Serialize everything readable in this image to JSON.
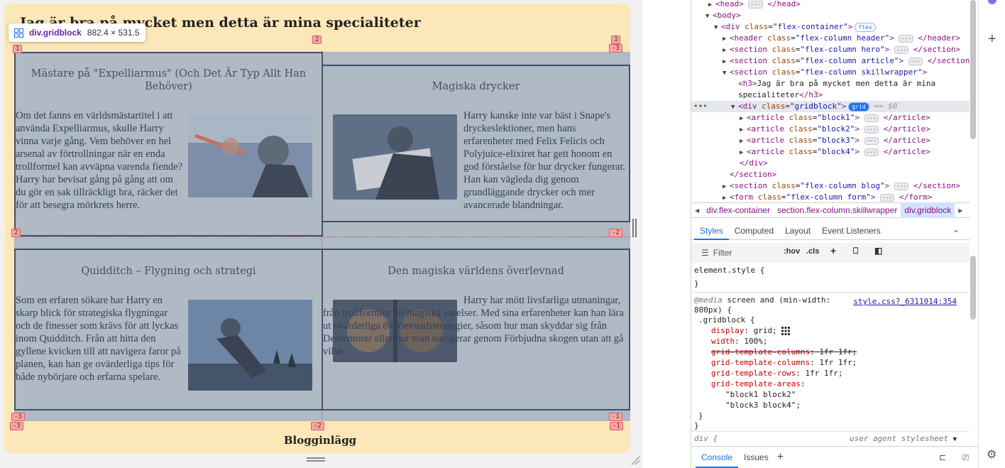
{
  "page": {
    "section_heading": "Jag är bra på mycket men detta är mina specialiteter",
    "blog_heading": "Blogginlägg"
  },
  "tooltip": {
    "selector": "div.gridblock",
    "size": "882.4 × 531.5"
  },
  "grid_badges": [
    "1",
    "2",
    "3",
    "-3",
    "2",
    "-2",
    "-3",
    "-1",
    "-3",
    "-2",
    "-1",
    "-1"
  ],
  "blocks": [
    {
      "title": "Mästare på \"Expelliarmus\" (Och Det Är Typ Allt Han Behöver)",
      "text": "Om det fanns en världsmästartitel i att använda Expelliarmus, skulle Harry vinna varje gång. Vem behöver en hel arsenal av förtrollningar när en enda trollformel kan avväpna varenda fiende? Harry har bevisat gång på gång att om du gör en sak tillräckligt bra, räcker det för att besegra mörkrets herre.",
      "image_icon": "harry-expelliarmus-image"
    },
    {
      "title": "Magiska drycker",
      "text": "Harry kanske inte var bäst i Snape's dryckeslektioner, men hans erfarenheter med Felix Felicis och Polyjuice-elixiret har gett honom en god förståelse för hur drycker fungerar. Han kan vägleda dig genom grundläggande drycker och mer avancerade blandningar.",
      "image_icon": "potion-book-image"
    },
    {
      "title": "Quidditch – Flygning och strategi",
      "text": "Som en erfaren sökare har Harry en skarp blick för strategiska flygningar och de finesser som krävs för att lyckas inom Quidditch. Från att hitta den gyllene kvicken till att navigera faror på planen, kan han ge ovärderliga tips för både nybörjare och erfarna spelare.",
      "image_icon": "quidditch-broom-image"
    },
    {
      "title": "Den magiska världens överlevnad",
      "text": "Harry har mött livsfarliga utmaningar, från trollformler till magiska varelser. Med sina erfarenheter kan han lära ut ovärderliga överlevnadsstrategier, såsom hur man skyddar sig från Dementorer eller hur man navigerar genom Förbjudna skogen utan att gå vilse.",
      "image_icon": "survival-face-image"
    }
  ],
  "dom": {
    "l1_head": "head",
    "l2_body": "body",
    "l3_container": "div",
    "l3_class": "flex-container",
    "l3_badge": "flex",
    "l4_header": "header",
    "l4_header_class": "flex-column header",
    "l5_section": "section",
    "l5_class": "flex-column hero",
    "l6_section": "section",
    "l6_class": "flex-column article",
    "l7_section": "section",
    "l7_class": "flex-column skillwrapper",
    "l8_h3": "h3",
    "l8_text1": "Jag är bra på mycket men detta är mina",
    "l8_text2": "specialiteter",
    "l9_div": "div",
    "l9_class": "gridblock",
    "l9_badge": "grid",
    "l9_dollar": "== $0",
    "articles": [
      "block1",
      "block2",
      "block3",
      "block4"
    ],
    "article_tag": "article",
    "l14_close": "div",
    "l15_close": "section",
    "l16_class": "flex-column blog",
    "l17_form": "form",
    "l17_class": "flex-column form",
    "attr_class": "class"
  },
  "breadcrumb": [
    "div.flex-container",
    "section.flex-column.skillwrapper",
    "div.gridblock"
  ],
  "styles_tabs": [
    "Styles",
    "Computed",
    "Layout",
    "Event Listeners"
  ],
  "filter": {
    "placeholder": "Filter",
    "hov": ":hov",
    "cls": ".cls"
  },
  "rules": {
    "element_style": "element.style {",
    "close": "}",
    "media_prefix": "@media",
    "media_query": "screen and (min-width:",
    "media_query2": "800px) {",
    "source": "style.css?_6311014:354",
    "selector": ".gridblock {",
    "decls": [
      {
        "prop": "display",
        "val": "grid;",
        "strike": false
      },
      {
        "prop": "width",
        "val": "100%;",
        "strike": false
      },
      {
        "prop": "grid-template-columns",
        "val": "1fr 1fr;",
        "strike": true
      },
      {
        "prop": "grid-template-columns",
        "val": "1fr 1fr;",
        "strike": false
      },
      {
        "prop": "grid-template-rows",
        "val": "1fr 1fr;",
        "strike": false
      },
      {
        "prop": "grid-template-areas",
        "val": "",
        "strike": false
      }
    ],
    "areas_1": "\"block1 block2\"",
    "areas_2": "\"block3 block4\";",
    "div_rule": "div {",
    "ua": "user agent stylesheet"
  },
  "drawer_tabs": [
    "Console",
    "Issues"
  ],
  "colors": {
    "card": "#fce7b8",
    "grid_overlay": "#6f96cd",
    "selection_purple": "#6b21a8",
    "devtools_accent": "#1a73e8"
  }
}
